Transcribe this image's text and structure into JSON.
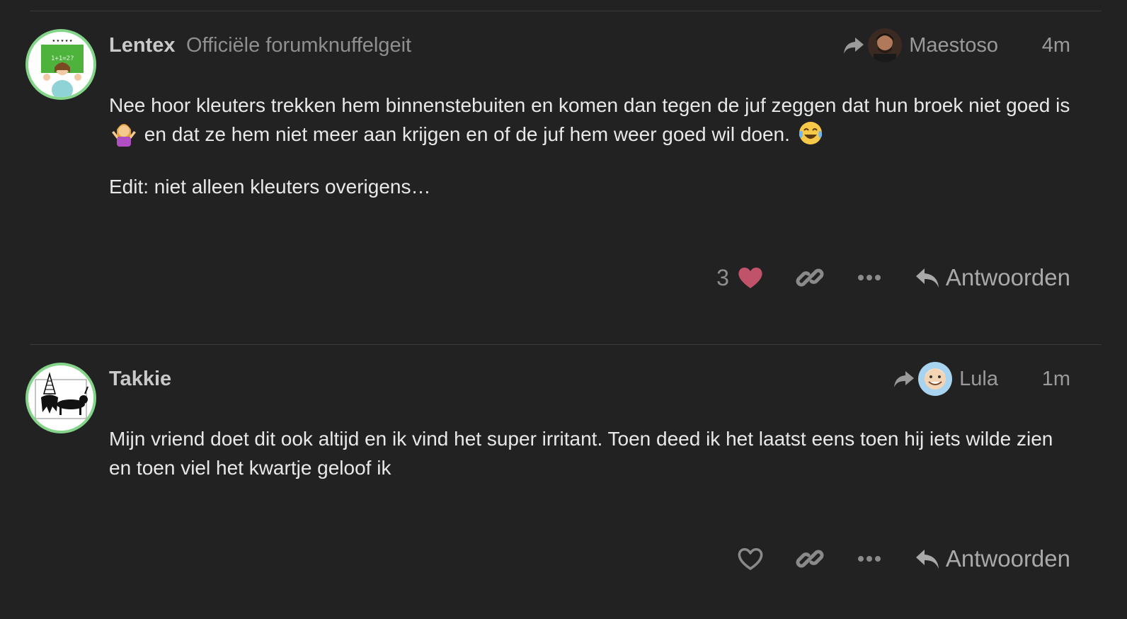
{
  "posts": [
    {
      "username": "Lentex",
      "user_title": "Officiële forumknuffelgeit",
      "avatar_icon": "teacher-chalkboard-avatar",
      "reply_to_user": "Maestoso",
      "time": "4m",
      "paragraphs": {
        "p1_a": "Nee hoor kleuters trekken hem binnenstebuiten en komen dan tegen de juf zeggen dat hun broek niet goed is",
        "p1_emoji1": "shrug-emoji",
        "p1_b": "en dat ze hem niet meer aan krijgen en of de juf hem weer goed wil doen.",
        "p1_emoji2": "laughing-tears-emoji",
        "p2": "Edit: niet alleen kleuters overigens…"
      },
      "like_count": "3",
      "liked": true,
      "reply_label": "Antwoorden"
    },
    {
      "username": "Takkie",
      "avatar_icon": "dachshund-party-avatar",
      "reply_to_user": "Lula",
      "time": "1m",
      "paragraphs": {
        "p1": "Mijn vriend doet dit ook altijd en ik vind het super irritant. Toen deed ik het laatst eens toen hij iets wilde zien en toen viel het kwartje geloof ik"
      },
      "liked": false,
      "reply_label": "Antwoorden"
    }
  ],
  "colors": {
    "background": "#222222",
    "avatar_ring": "#84d48a",
    "like_heart": "#c0526a",
    "text": "#e8e8e8",
    "muted": "#8f8f8f"
  }
}
